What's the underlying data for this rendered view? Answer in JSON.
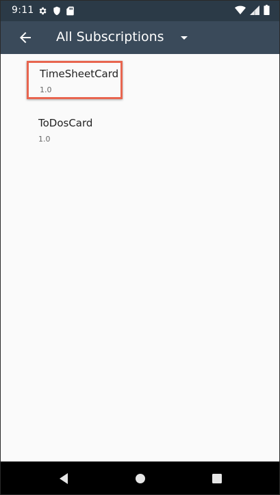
{
  "status_bar": {
    "time": "9:11",
    "left_icons": [
      "settings-icon",
      "shield-icon",
      "sd-card-icon"
    ],
    "right_icons": [
      "wifi-icon",
      "cell-signal-icon",
      "battery-icon"
    ]
  },
  "app_bar": {
    "title": "All Subscriptions",
    "back_icon": "arrow-back-icon",
    "dropdown_icon": "dropdown-arrow-icon"
  },
  "subscriptions": [
    {
      "name": "TimeSheetCard",
      "version": "1.0",
      "highlighted": true
    },
    {
      "name": "ToDosCard",
      "version": "1.0",
      "highlighted": false
    }
  ],
  "nav_bar": {
    "buttons": [
      "nav-back-icon",
      "nav-home-icon",
      "nav-recents-icon"
    ]
  },
  "colors": {
    "status_bar": "#2b3a47",
    "app_bar": "#3a4a5a",
    "highlight_border": "#e8654f",
    "background": "#fafafa"
  }
}
